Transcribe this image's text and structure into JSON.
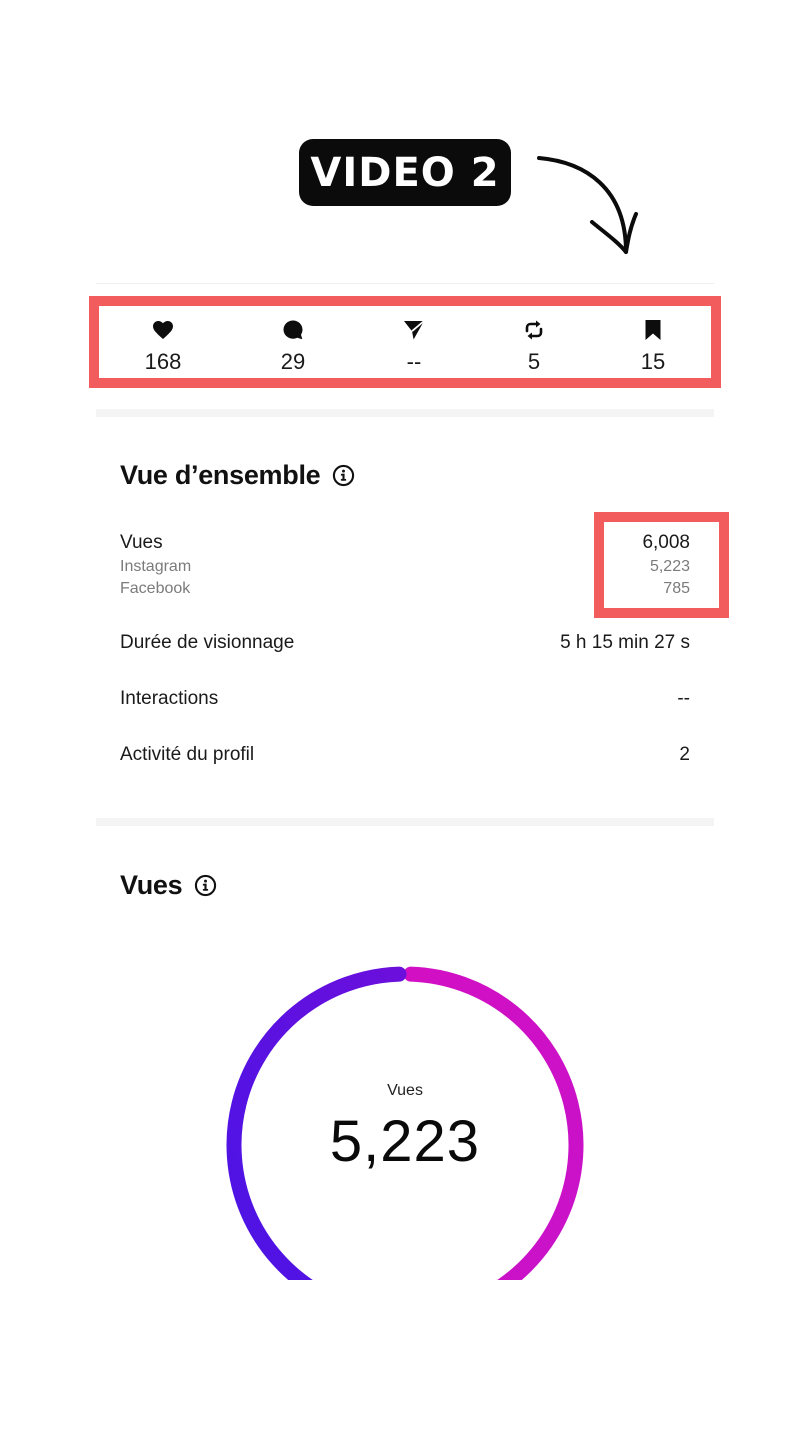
{
  "badge": {
    "label": "VIDEO 2"
  },
  "stats": [
    {
      "icon": "heart-icon",
      "value": "168"
    },
    {
      "icon": "comment-icon",
      "value": "29"
    },
    {
      "icon": "send-icon",
      "value": "--"
    },
    {
      "icon": "repost-icon",
      "value": "5"
    },
    {
      "icon": "bookmark-icon",
      "value": "15"
    }
  ],
  "overview": {
    "title": "Vue d’ensemble",
    "views": {
      "label": "Vues",
      "value": "6,008",
      "instagram_label": "Instagram",
      "instagram_value": "5,223",
      "facebook_label": "Facebook",
      "facebook_value": "785"
    },
    "watch_time": {
      "label": "Durée de visionnage",
      "value": "5 h 15 min 27 s"
    },
    "interactions": {
      "label": "Interactions",
      "value": "--"
    },
    "profile_activity": {
      "label": "Activité du profil",
      "value": "2"
    }
  },
  "views_section": {
    "title": "Vues",
    "donut_label": "Vues",
    "donut_value": "5,223",
    "segments": [
      {
        "name": "Instagram",
        "value": 5223,
        "color": "#d20fc3"
      },
      {
        "name": "Facebook",
        "value": 785,
        "color": "#6a0fe0"
      }
    ]
  },
  "colors": {
    "highlight": "#f25c5c",
    "badge_bg": "#0b0b0b",
    "donut_magenta": "#d20fc3",
    "donut_purple": "#5f10e0"
  }
}
